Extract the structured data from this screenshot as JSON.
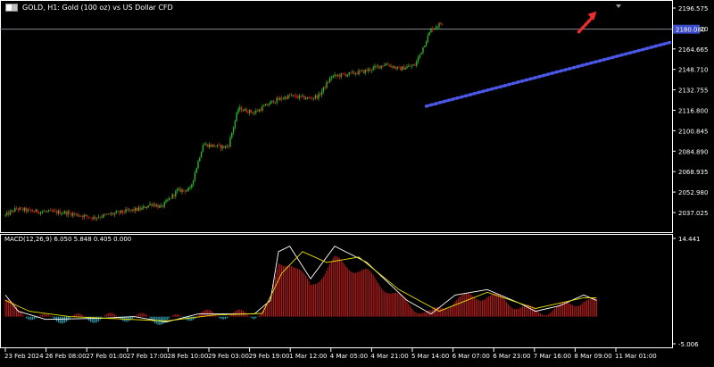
{
  "title": {
    "text": "GOLD, H1:  Gold (100 oz) vs US Dollar CFD"
  },
  "macd": {
    "label": "MACD(12,26,9) 6.050 5.848 0.405 0.000"
  },
  "colors": {
    "background": "#000000",
    "grid": "#ffffff",
    "bull": "#2fb52f",
    "bear": "#e01a1a",
    "macd_line": "#ffffff",
    "signal_line": "#e6e000",
    "hist_pos": "#c02020",
    "hist_neg": "#35b2c3",
    "trendline": "#4b57e8",
    "arrow": "#ee2d2d"
  },
  "current_price": "2180.080",
  "chart_data": {
    "type": "candlestick",
    "price_axis": [
      "2196.575",
      "2180.620",
      "2164.665",
      "2148.710",
      "2132.755",
      "2116.800",
      "2100.845",
      "2084.890",
      "2068.935",
      "2052.980",
      "2037.025"
    ],
    "macd_axis": [
      "14.441",
      "-5.006"
    ],
    "time_axis": [
      "23 Feb 2024",
      "26 Feb 08:00",
      "27 Feb 01:00",
      "27 Feb 17:00",
      "28 Feb 10:00",
      "29 Feb 03:00",
      "29 Feb 19:00",
      "1 Mar 12:00",
      "4 Mar 05:00",
      "4 Mar 21:00",
      "5 Mar 14:00",
      "6 Mar 07:00",
      "6 Mar 23:00",
      "7 Mar 16:00",
      "8 Mar 09:00",
      "11 Mar 01:00"
    ],
    "segments": [
      {
        "from": 2034,
        "to": 2040,
        "bars": 8
      },
      {
        "from": 2040,
        "to": 2038,
        "bars": 10
      },
      {
        "from": 2038,
        "to": 2037,
        "bars": 20
      },
      {
        "from": 2037,
        "to": 2033,
        "bars": 18
      },
      {
        "from": 2033,
        "to": 2038,
        "bars": 20
      },
      {
        "from": 2038,
        "to": 2040,
        "bars": 10
      },
      {
        "from": 2040,
        "to": 2044,
        "bars": 6
      },
      {
        "from": 2044,
        "to": 2041,
        "bars": 6
      },
      {
        "from": 2041,
        "to": 2054,
        "bars": 10
      },
      {
        "from": 2054,
        "to": 2055,
        "bars": 8
      },
      {
        "from": 2055,
        "to": 2090,
        "bars": 8
      },
      {
        "from": 2090,
        "to": 2088,
        "bars": 14
      },
      {
        "from": 2088,
        "to": 2090,
        "bars": 2
      },
      {
        "from": 2090,
        "to": 2118,
        "bars": 6
      },
      {
        "from": 2118,
        "to": 2115,
        "bars": 10
      },
      {
        "from": 2115,
        "to": 2124,
        "bars": 12
      },
      {
        "from": 2124,
        "to": 2128,
        "bars": 10
      },
      {
        "from": 2128,
        "to": 2126,
        "bars": 12
      },
      {
        "from": 2126,
        "to": 2128,
        "bars": 6
      },
      {
        "from": 2128,
        "to": 2143,
        "bars": 8
      },
      {
        "from": 2143,
        "to": 2147,
        "bars": 20
      },
      {
        "from": 2147,
        "to": 2153,
        "bars": 14
      },
      {
        "from": 2153,
        "to": 2149,
        "bars": 8
      },
      {
        "from": 2149,
        "to": 2152,
        "bars": 10
      },
      {
        "from": 2152,
        "to": 2180,
        "bars": 10
      },
      {
        "from": 2180,
        "to": 2185,
        "bars": 7
      }
    ],
    "macd_points": [
      [
        0,
        4
      ],
      [
        8,
        1
      ],
      [
        25,
        -0.5
      ],
      [
        60,
        -0.3
      ],
      [
        80,
        0
      ],
      [
        100,
        -1
      ],
      [
        120,
        0.5
      ],
      [
        135,
        0.5
      ],
      [
        155,
        0.5
      ],
      [
        165,
        3
      ],
      [
        170,
        12
      ],
      [
        177,
        13
      ],
      [
        190,
        7
      ],
      [
        205,
        13
      ],
      [
        225,
        10
      ],
      [
        250,
        3
      ],
      [
        265,
        0.5
      ],
      [
        280,
        4
      ],
      [
        300,
        5
      ],
      [
        320,
        2.5
      ],
      [
        330,
        1
      ],
      [
        345,
        2
      ],
      [
        360,
        4
      ],
      [
        368,
        3
      ]
    ],
    "signal_points": [
      [
        0,
        3
      ],
      [
        15,
        1
      ],
      [
        40,
        0
      ],
      [
        100,
        -0.8
      ],
      [
        130,
        0.3
      ],
      [
        160,
        0.6
      ],
      [
        172,
        8
      ],
      [
        185,
        12
      ],
      [
        200,
        10
      ],
      [
        220,
        11
      ],
      [
        245,
        5
      ],
      [
        270,
        1
      ],
      [
        300,
        4.5
      ],
      [
        330,
        1.5
      ],
      [
        360,
        3.5
      ],
      [
        368,
        3.5
      ]
    ],
    "trendline": {
      "from": [
        262,
        2120
      ],
      "to": [
        380,
        2170
      ]
    },
    "arrow": {
      "from": [
        357,
        2178
      ],
      "to": [
        368,
        2194
      ]
    }
  }
}
